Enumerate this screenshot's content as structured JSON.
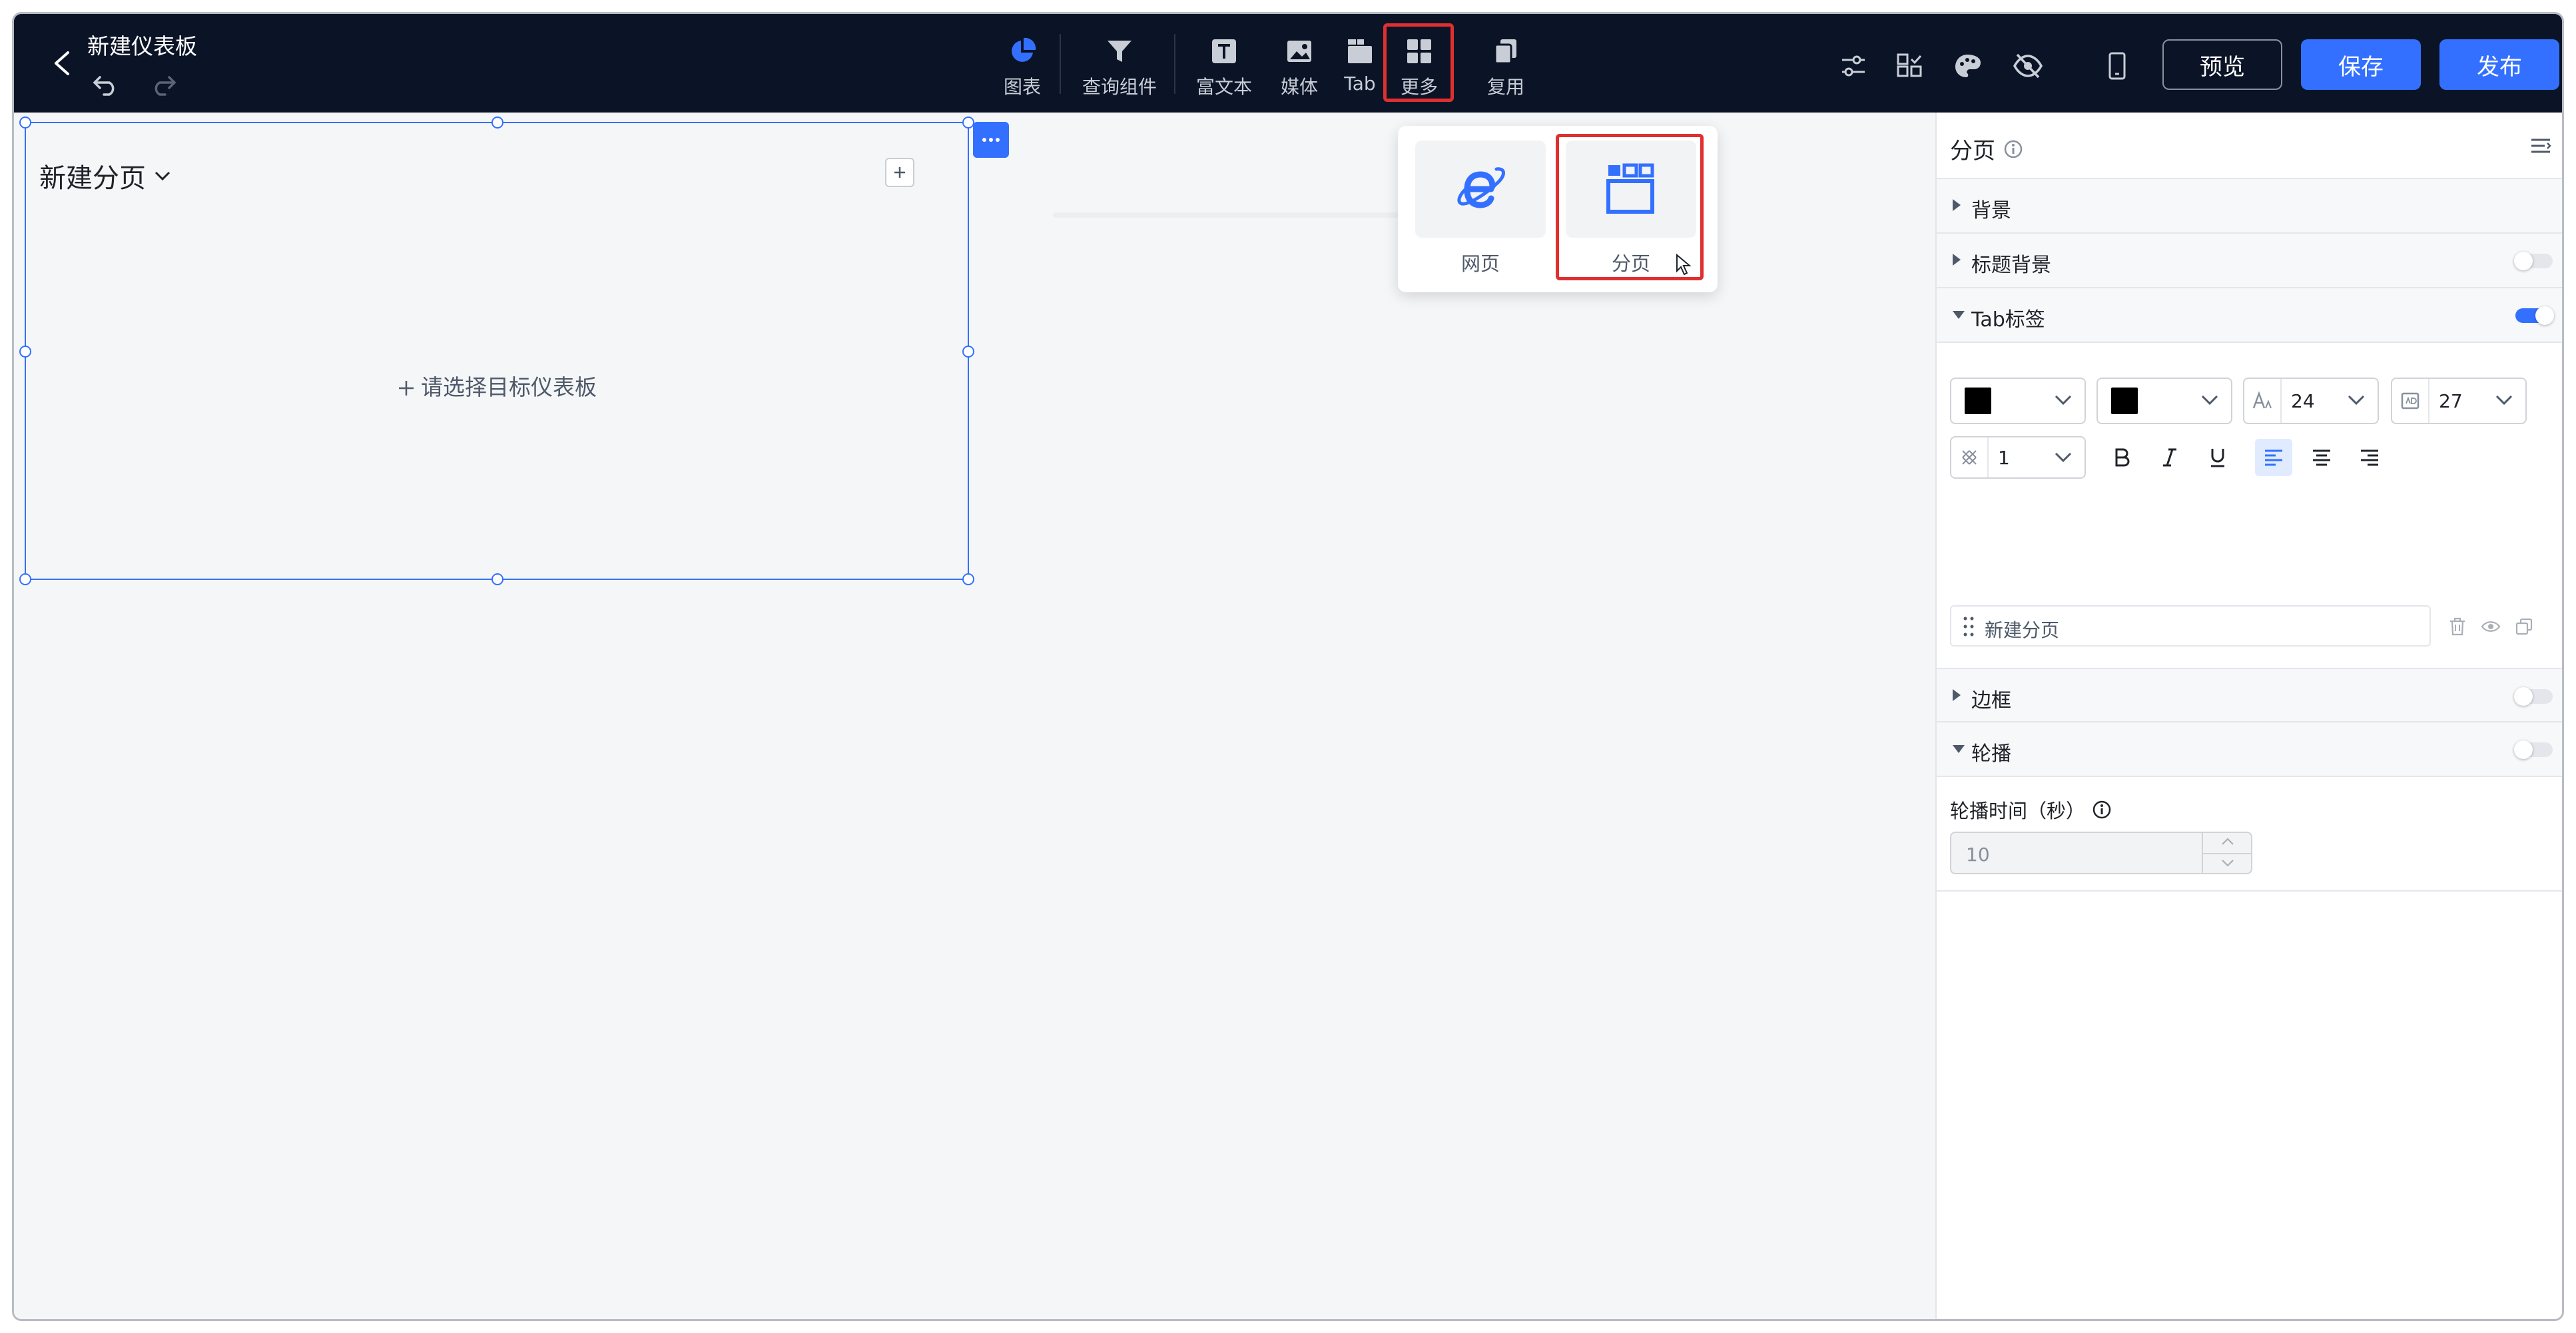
{
  "header": {
    "title": "新建仪表板",
    "tools": [
      {
        "id": "chart",
        "label": "图表",
        "icon": "pie-chart-icon"
      },
      {
        "id": "query",
        "label": "查询组件",
        "icon": "filter-icon"
      },
      {
        "id": "richtext",
        "label": "富文本",
        "icon": "text-icon"
      },
      {
        "id": "media",
        "label": "媒体",
        "icon": "image-icon"
      },
      {
        "id": "tab",
        "label": "Tab",
        "icon": "tab-icon"
      },
      {
        "id": "more",
        "label": "更多",
        "icon": "grid-icon"
      },
      {
        "id": "reuse",
        "label": "复用",
        "icon": "copy-icon"
      }
    ],
    "buttons": {
      "preview": "预览",
      "save": "保存",
      "publish": "发布"
    }
  },
  "canvas": {
    "widget": {
      "title": "新建分页",
      "placeholder": "请选择目标仪表板"
    }
  },
  "dropdown": {
    "items": [
      {
        "label": "网页",
        "icon": "webpage-icon"
      },
      {
        "label": "分页",
        "icon": "pagination-icon"
      }
    ]
  },
  "panel": {
    "title": "分页",
    "sections": {
      "background": "背景",
      "title_background": "标题背景",
      "tab_labels": "Tab标签",
      "border": "边框",
      "carousel": "轮播"
    },
    "toggles": {
      "title_background": false,
      "tab_labels": true,
      "border": false,
      "carousel": false
    },
    "tab_style": {
      "font_color": "#000000",
      "bg_color": "#000000",
      "font_size": "24",
      "height": "27",
      "line_width": "1",
      "alignment": "left"
    },
    "tab_item": "新建分页",
    "carousel_time_label": "轮播时间（秒）",
    "carousel_time_value": "10"
  },
  "colors": {
    "accent": "#3370ff",
    "topbar": "#0b1426",
    "highlight": "#e02f2f"
  }
}
